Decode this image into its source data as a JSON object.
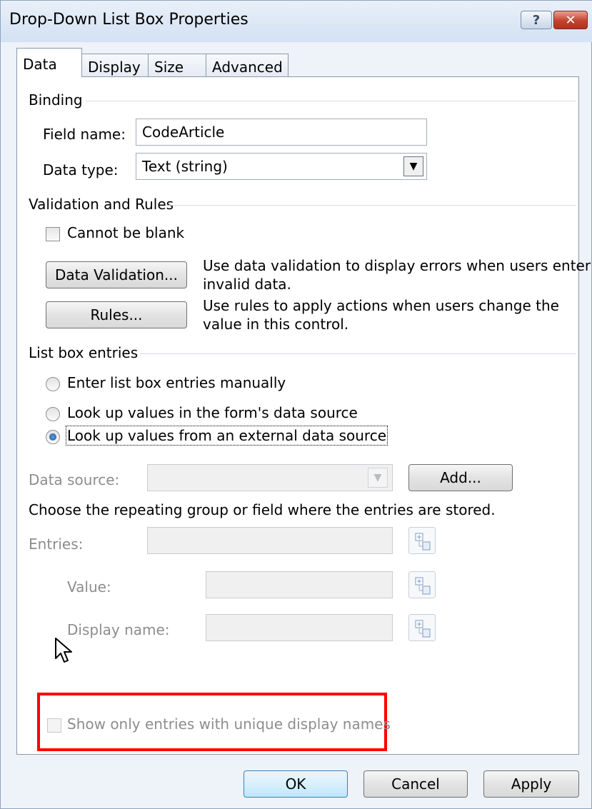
{
  "window": {
    "title": "Drop-Down List Box Properties",
    "help_glyph": "?",
    "close_glyph": "✕"
  },
  "tabs": [
    {
      "label": "Data",
      "active": true
    },
    {
      "label": "Display",
      "active": false
    },
    {
      "label": "Size",
      "active": false
    },
    {
      "label": "Advanced",
      "active": false
    }
  ],
  "binding": {
    "heading": "Binding",
    "field_name_label": "Field name:",
    "field_name_value": "CodeArticle",
    "data_type_label": "Data type:",
    "data_type_value": "Text (string)"
  },
  "validation": {
    "heading": "Validation and Rules",
    "cannot_be_blank_label": "Cannot be blank",
    "cannot_be_blank_checked": false,
    "data_validation_button": "Data Validation...",
    "data_validation_desc_1": "Use data validation to display errors when users enter",
    "data_validation_desc_2": "invalid data.",
    "rules_button": "Rules...",
    "rules_desc_1": "Use rules to apply actions when users change the",
    "rules_desc_2": "value in this control."
  },
  "list_entries": {
    "heading": "List box entries",
    "option_manual": "Enter list box entries manually",
    "option_form_source": "Look up values in the form's data source",
    "option_external": "Look up values from an external data source",
    "selected_option": "external",
    "data_source_label": "Data source:",
    "data_source_value": "",
    "add_button": "Add...",
    "instruction": "Choose the repeating group or field where the entries are stored.",
    "entries_label": "Entries:",
    "value_label": "Value:",
    "display_name_label": "Display name:",
    "unique_names_label": "Show only entries with unique display names",
    "unique_names_checked": false
  },
  "footer": {
    "ok_button": "OK",
    "cancel_button": "Cancel",
    "apply_button": "Apply"
  },
  "colors": {
    "highlight": "#ff0000",
    "default_button_border": "#3c7fb1",
    "close_button": "#c3422f"
  },
  "icons": {
    "help": "question-mark-icon",
    "close": "close-icon",
    "dropdown": "triangle-down-icon",
    "xpath": "xpath-tree-icon",
    "cursor": "mouse-pointer-icon"
  }
}
